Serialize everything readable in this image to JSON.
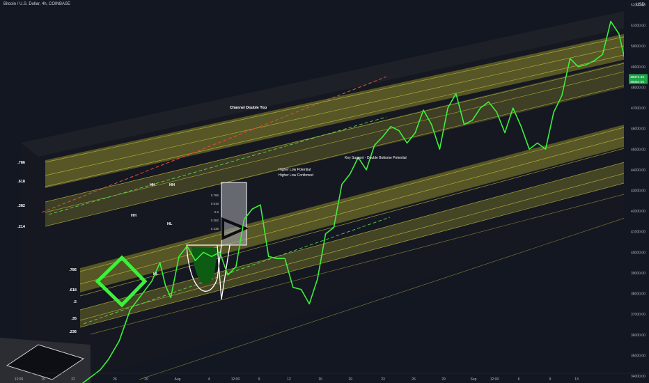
{
  "header": {
    "symbol_title": "Bitcoin / U.S. Dollar, 4h, COINBASE",
    "currency": "USD"
  },
  "price_badges": [
    {
      "label": "48371.58",
      "color": "#1fa64a"
    },
    {
      "label": "48364.00",
      "color": "#1fa64a"
    }
  ],
  "chart_data": {
    "type": "line",
    "series": [
      {
        "x": [
          "2021-07-20T20:00",
          "2021-07-21T12:00",
          "2021-07-22T04:00",
          "2021-07-22T16:00",
          "2021-07-23T08:00",
          "2021-07-24T00:00",
          "2021-07-24T16:00",
          "2021-07-25T08:00",
          "2021-07-25T20:00",
          "2021-07-26T04:00",
          "2021-07-26T12:00",
          "2021-07-27T00:00",
          "2021-07-27T12:00",
          "2021-07-28T00:00",
          "2021-07-28T12:00",
          "2021-07-29T00:00",
          "2021-07-29T12:00",
          "2021-07-30T00:00",
          "2021-07-30T12:00",
          "2021-07-31T00:00",
          "2021-07-31T12:00",
          "2021-08-01T00:00",
          "2021-08-01T12:00",
          "2021-08-02T00:00",
          "2021-08-02T12:00",
          "2021-08-03T00:00",
          "2021-08-03T12:00",
          "2021-08-04T00:00",
          "2021-08-04T12:00",
          "2021-08-05T00:00",
          "2021-08-05T12:00",
          "2021-08-06T00:00",
          "2021-08-06T12:00",
          "2021-08-07T00:00",
          "2021-08-07T12:00",
          "2021-08-08T00:00",
          "2021-08-08T12:00",
          "2021-08-09T00:00",
          "2021-08-09T12:00",
          "2021-08-10T00:00",
          "2021-08-10T12:00",
          "2021-08-11T00:00",
          "2021-08-11T12:00",
          "2021-08-12T00:00",
          "2021-08-12T12:00",
          "2021-08-13T00:00",
          "2021-08-13T12:00",
          "2021-08-14T00:00",
          "2021-08-14T12:00",
          "2021-08-15T00:00",
          "2021-08-15T12:00",
          "2021-08-16T00:00",
          "2021-08-16T12:00",
          "2021-08-17T00:00",
          "2021-08-17T12:00",
          "2021-08-18T00:00",
          "2021-08-18T12:00",
          "2021-08-19T00:00",
          "2021-08-19T12:00",
          "2021-08-20T00:00",
          "2021-08-20T12:00",
          "2021-08-21T00:00",
          "2021-08-21T12:00",
          "2021-08-22T00:00",
          "2021-08-22T12:00",
          "2021-08-23T00:00",
          "2021-08-23T12:00",
          "2021-08-24T00:00",
          "2021-08-24T12:00",
          "2021-08-25T00:00",
          "2021-08-25T12:00",
          "2021-08-26T00:00",
          "2021-08-26T12:00",
          "2021-08-27T00:00",
          "2021-08-27T12:00",
          "2021-08-28T00:00",
          "2021-08-28T12:00",
          "2021-08-29T00:00",
          "2021-08-29T12:00",
          "2021-08-30T00:00",
          "2021-08-30T12:00",
          "2021-08-31T00:00",
          "2021-08-31T12:00"
        ],
        "y": [
          33500,
          33900,
          34300,
          34800,
          35700,
          37200,
          37900,
          38600,
          39500,
          38400,
          37800,
          39800,
          40300,
          39600,
          40000,
          39800,
          40000,
          38900,
          39300,
          41600,
          42100,
          42300,
          39800,
          39700,
          39700,
          38300,
          38200,
          37500,
          38700,
          40900,
          41200,
          43300,
          43800,
          44600,
          44000,
          45200,
          45600,
          46100,
          45900,
          45300,
          45800,
          46900,
          46200,
          45000,
          47000,
          47700,
          46200,
          46400,
          47000,
          47300,
          46800,
          45800,
          47000,
          46100,
          45000,
          45300,
          45000,
          46800,
          47600,
          49400,
          49000,
          49100,
          49300,
          49600,
          51200,
          50600,
          48900,
          47900,
          48700,
          47300,
          47200,
          47100,
          48700,
          49300,
          48600,
          48800,
          48300,
          48400,
          48700,
          47200,
          46800,
          47100,
          48200
        ]
      }
    ],
    "y_ticks": [
      52000,
      51000,
      50000,
      49000,
      48000,
      47000,
      46000,
      45000,
      44000,
      43000,
      42000,
      41000,
      40000,
      39000,
      38000,
      37000,
      36000,
      35000,
      34000
    ],
    "x_ticks": [
      "12:00",
      "19",
      "22",
      "26",
      "29",
      "Aug",
      "4",
      "12:00",
      "9",
      "12",
      "16",
      "19",
      "23",
      "26",
      "29",
      "Sep",
      "12:00",
      "6",
      "9",
      "13"
    ],
    "fib_labels_upper": [
      ".786",
      ".618",
      ".382",
      ".214"
    ],
    "fib_labels_lower": [
      ".786",
      ".618",
      ".5",
      ".35",
      ".236"
    ],
    "fib_box_labels": [
      "0.786",
      "0.618",
      "0.5",
      "0.382",
      "0.236"
    ],
    "annotations": {
      "channel_double_top": "Channel Double Top",
      "higher_low": "Higher Low Potential",
      "higher_low_confirmed": "Higher Low Confirmed",
      "key_support": "Key Support - Double Bottome Potential",
      "hh1": "HH",
      "hh2": "HH",
      "hh3": "HH",
      "hl1": "HL",
      "hl2": "HL"
    },
    "colors": {
      "background": "#131722",
      "price_line": "#3cf03c",
      "channel_yellow": "#d6cf43",
      "resistance_red": "#e04a3a"
    }
  }
}
